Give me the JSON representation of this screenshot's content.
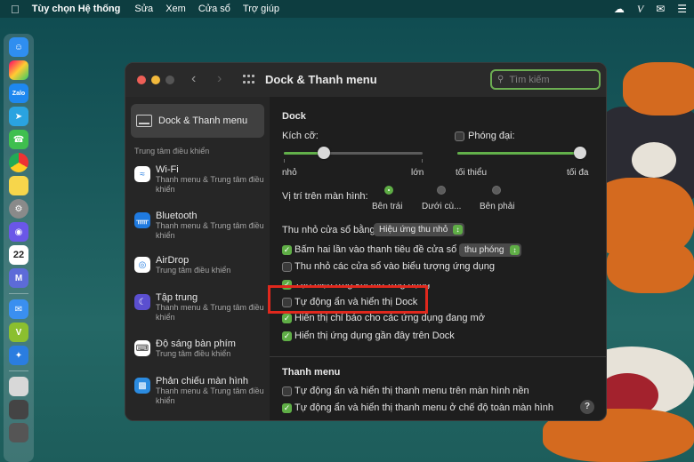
{
  "menubar": {
    "app_name": "Tùy chọn Hệ thống",
    "items": [
      "Sửa",
      "Xem",
      "Cửa sổ",
      "Trợ giúp"
    ]
  },
  "dock": {
    "icons": [
      "finder-icon",
      "launchpad-icon",
      "zalo-icon",
      "telegram-icon",
      "whatsapp-icon",
      "chrome-icon",
      "notes-icon",
      "settings-icon",
      "discord-icon",
      "calendar-icon",
      "cursor-icon",
      "mail-icon",
      "vectorize-icon",
      "bird-icon"
    ],
    "calendar_day": "22",
    "zalo_label": "Zalo"
  },
  "window": {
    "title": "Dock & Thanh menu",
    "search_placeholder": "Tìm kiếm"
  },
  "sidebar": {
    "selected": "Dock & Thanh menu",
    "section_header": "Trung tâm điều khiển",
    "items": [
      {
        "title": "Wi-Fi",
        "subtitle": "Thanh menu & Trung tâm điều khiển",
        "color": "#ffffff"
      },
      {
        "title": "Bluetooth",
        "subtitle": "Thanh menu & Trung tâm điều khiển",
        "color": "#1f7ae0"
      },
      {
        "title": "AirDrop",
        "subtitle": "Trung tâm điều khiển",
        "color": "#ffffff"
      },
      {
        "title": "Tập trung",
        "subtitle": "Thanh menu & Trung tâm điều khiển",
        "color": "#5b4fd0"
      },
      {
        "title": "Độ sáng bàn phím",
        "subtitle": "Trung tâm điều khiển",
        "color": "#ffffff"
      },
      {
        "title": "Phản chiếu màn hình",
        "subtitle": "Thanh menu & Trung tâm điều khiển",
        "color": "#2b8be0"
      }
    ]
  },
  "dock_section": {
    "title": "Dock",
    "size_label": "Kích cỡ:",
    "size_min": "nhỏ",
    "size_max": "lớn",
    "size_value": 0.2,
    "magnify_label": "Phóng đại:",
    "magnify_checked": false,
    "magnify_min": "tối thiểu",
    "magnify_max": "tối đa",
    "magnify_value": 1.0,
    "position_label": "Vị trí trên màn hình:",
    "positions": [
      "Bên trái",
      "Dưới cù...",
      "Bên phải"
    ],
    "position_selected": "Bên trái",
    "minimize_label": "Thu nhỏ cửa sổ bằng:",
    "minimize_value": "Hiệu ứng thu nhỏ",
    "dblclick_label": "Bấm hai lần vào thanh tiêu đề cửa sổ để",
    "dblclick_value": "thu phóng",
    "options": [
      {
        "label": "Bấm hai lần vào thanh tiêu đề cửa sổ để",
        "checked": true
      },
      {
        "label": "Thu nhỏ các cửa sổ vào biểu tượng ứng dụng",
        "checked": false
      },
      {
        "label": "Tạo hiệu ứng khi mở ứng dụng",
        "checked": true
      },
      {
        "label": "Tự động ẩn và hiển thị Dock",
        "checked": false
      },
      {
        "label": "Hiển thị chỉ báo cho các ứng dụng đang mở",
        "checked": true
      },
      {
        "label": "Hiển thị ứng dụng gần đây trên Dock",
        "checked": true
      }
    ]
  },
  "menubar_section": {
    "title": "Thanh menu",
    "options": [
      {
        "label": "Tự động ẩn và hiển thị thanh menu trên màn hình nền",
        "checked": false
      },
      {
        "label": "Tự động ẩn và hiển thị thanh menu ở chế độ toàn màn hình",
        "checked": true
      }
    ]
  },
  "help_label": "?",
  "colors": {
    "accent": "#5fae46",
    "highlight_box": "#e0281d",
    "window_bg": "#1e1e1e"
  }
}
